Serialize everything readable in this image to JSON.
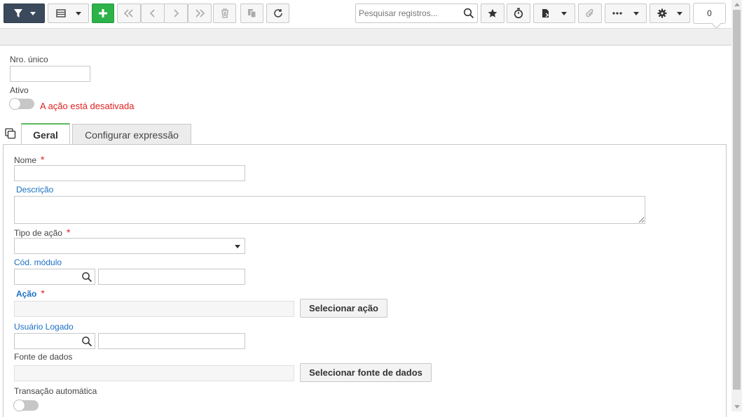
{
  "toolbar": {
    "search_placeholder": "Pesquisar registros...",
    "counter": "0"
  },
  "form": {
    "nro_unico_label": "Nro. único",
    "ativo_label": "Ativo",
    "ativo_state": "off",
    "ativo_warning": "A ação está desativada"
  },
  "tabs": [
    {
      "label": "Geral",
      "active": true
    },
    {
      "label": "Configurar expressão",
      "active": false
    }
  ],
  "geral": {
    "nome_label": "Nome",
    "descricao_label": "Descrição",
    "tipo_acao_label": "Tipo de ação",
    "cod_modulo_label": "Cód. módulo",
    "acao_label": "Ação",
    "selecionar_acao_button": "Selecionar ação",
    "usuario_logado_label": "Usuário Logado",
    "fonte_dados_label": "Fonte de dados",
    "selecionar_fonte_button": "Selecionar fonte de dados",
    "transacao_automatica_label": "Transação automática",
    "transacao_automatica_state": "off",
    "required_mark": "*"
  },
  "colors": {
    "accent_green": "#2eb24a",
    "label_blue": "#1a6fc4",
    "warning_red": "#e02020",
    "filter_button": "#3a4a5c"
  },
  "icons": [
    "filter-icon",
    "grid-icon",
    "add-icon",
    "first-icon",
    "previous-icon",
    "next-icon",
    "last-icon",
    "delete-icon",
    "duplicate-icon",
    "refresh-icon",
    "search-icon",
    "star-icon",
    "timer-icon",
    "export-icon",
    "attach-icon",
    "more-icon",
    "gear-icon",
    "tabs-icon"
  ]
}
